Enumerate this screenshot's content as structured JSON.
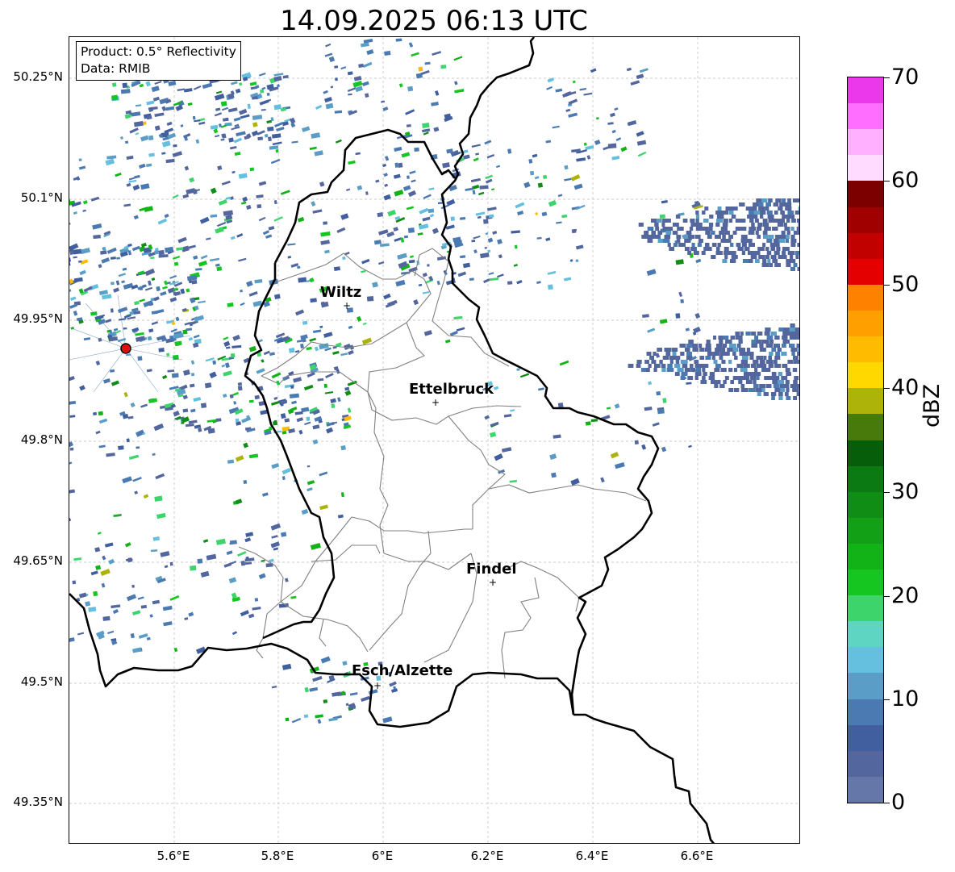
{
  "title": "14.09.2025 06:13 UTC",
  "info_box": {
    "product": "Product: 0.5° Reflectivity",
    "data": "Data: RMIB"
  },
  "map": {
    "lat_ticks": [
      "50.25°N",
      "50.1°N",
      "49.95°N",
      "49.8°N",
      "49.65°N",
      "49.5°N",
      "49.35°N"
    ],
    "lon_ticks": [
      "5.6°E",
      "5.8°E",
      "6°E",
      "6.2°E",
      "6.4°E",
      "6.6°E"
    ],
    "cities": [
      {
        "name": "Wiltz"
      },
      {
        "name": "Ettelbruck"
      },
      {
        "name": "Findel"
      },
      {
        "name": "Esch/Alzette"
      }
    ]
  },
  "colorbar": {
    "label": "dBZ",
    "min": 0,
    "max": 70,
    "step": 2.5,
    "ticks": [
      "70",
      "60",
      "50",
      "40",
      "30",
      "20",
      "10",
      "0"
    ],
    "colors": [
      "#6577a8",
      "#53679e",
      "#415e9f",
      "#4b7ab3",
      "#5a9ec8",
      "#65c0df",
      "#5ed5c3",
      "#3ed46c",
      "#14c61f",
      "#12b317",
      "#11a016",
      "#0f8d14",
      "#0c7a12",
      "#075e0a",
      "#477a0a",
      "#adb308",
      "#ffd800",
      "#ffbb00",
      "#ffa000",
      "#ff8100",
      "#e40000",
      "#c10000",
      "#a10000",
      "#7c0000",
      "#ffdcff",
      "#ffb1ff",
      "#ff6eff",
      "#ea38ea"
    ]
  },
  "colors": {
    "border_country": "#000000",
    "border_canton": "#808080",
    "grid": "#bbbbbb",
    "radar_site": "#e01010"
  }
}
